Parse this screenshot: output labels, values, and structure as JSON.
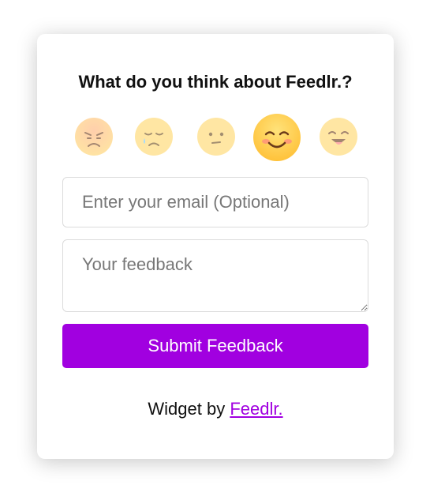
{
  "widget": {
    "question": "What do you think about Feedlr.?",
    "ratings": [
      {
        "icon": "angry-face-icon",
        "selected": false
      },
      {
        "icon": "sad-face-icon",
        "selected": false
      },
      {
        "icon": "neutral-face-icon",
        "selected": false
      },
      {
        "icon": "smiling-face-icon",
        "selected": true
      },
      {
        "icon": "laughing-face-icon",
        "selected": false
      }
    ],
    "email": {
      "value": "",
      "placeholder": "Enter your email (Optional)"
    },
    "feedback": {
      "value": "",
      "placeholder": "Your feedback"
    },
    "submit_label": "Submit Feedback",
    "footer": {
      "prefix": "Widget by ",
      "link_text": "Feedlr."
    }
  },
  "colors": {
    "accent": "#a100e0",
    "face_yellow": "#ffd54f",
    "face_orange": "#ffa94d"
  }
}
